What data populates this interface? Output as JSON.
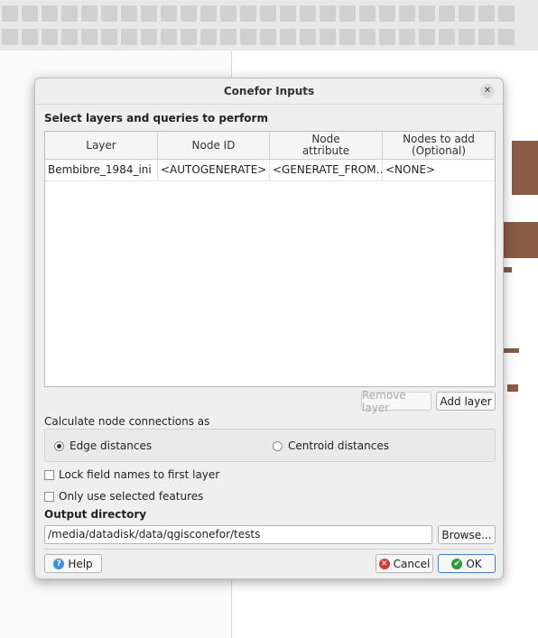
{
  "dialog": {
    "title": "Conefor Inputs",
    "close_icon": "close-icon",
    "layers_section_title": "Select layers and queries to perform",
    "table": {
      "columns": [
        "Layer",
        "Node ID",
        "Node\nattribute",
        "Nodes to add\n(Optional)"
      ],
      "rows": [
        [
          "Bembibre_1984_ini",
          "<AUTOGENERATE>",
          "<GENERATE_FROM…",
          "<NONE>"
        ]
      ]
    },
    "remove_layer_label": "Remove layer",
    "add_layer_label": "Add layer",
    "connections_label": "Calculate node connections as",
    "radio_edge_label": "Edge distances",
    "radio_centroid_label": "Centroid distances",
    "selected_connection": "Edge distances",
    "lock_field_label": "Lock field names to first layer",
    "only_selected_label": "Only use selected features",
    "output_title": "Output directory",
    "output_path": "/media/datadisk/data/qgisconefor/tests",
    "browse_label": "Browse...",
    "help_label": "Help",
    "cancel_label": "Cancel",
    "ok_label": "OK",
    "colors": {
      "help_icon": "#3d8fe0",
      "cancel_icon": "#d83b3b",
      "ok_icon": "#2e9b3a",
      "ok_border": "#3a7fd0"
    }
  }
}
